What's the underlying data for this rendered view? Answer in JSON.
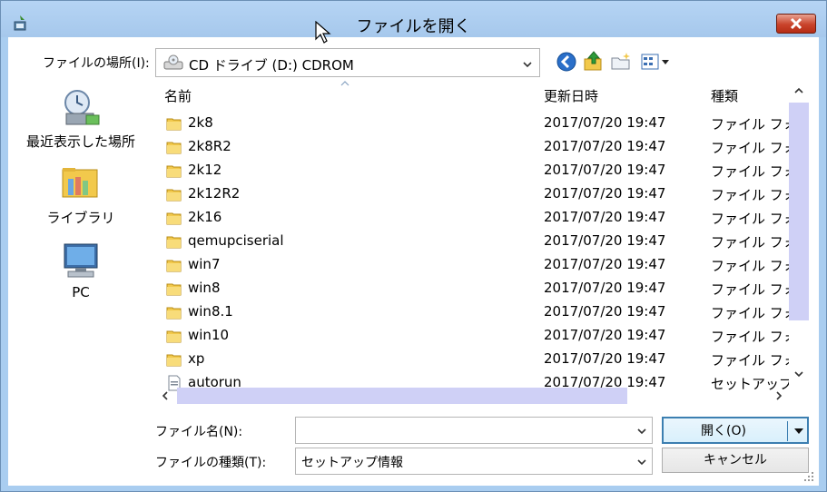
{
  "window": {
    "title": "ファイルを開く"
  },
  "location": {
    "label": "ファイルの場所(I):",
    "value": "CD ドライブ (D:) CDROM"
  },
  "toolbar": {
    "icons": [
      "back-icon",
      "up-folder-icon",
      "new-folder-icon",
      "view-menu-icon"
    ]
  },
  "places": [
    {
      "label": "最近表示した場所",
      "icon": "recent-places-icon"
    },
    {
      "label": "ライブラリ",
      "icon": "libraries-icon"
    },
    {
      "label": "PC",
      "icon": "computer-icon"
    }
  ],
  "columns": {
    "name": "名前",
    "date": "更新日時",
    "type": "種類"
  },
  "files": [
    {
      "name": "2k8",
      "date": "2017/07/20 19:47",
      "type": "ファイル フォルダー",
      "kind": "folder"
    },
    {
      "name": "2k8R2",
      "date": "2017/07/20 19:47",
      "type": "ファイル フォルダー",
      "kind": "folder"
    },
    {
      "name": "2k12",
      "date": "2017/07/20 19:47",
      "type": "ファイル フォルダー",
      "kind": "folder"
    },
    {
      "name": "2k12R2",
      "date": "2017/07/20 19:47",
      "type": "ファイル フォルダー",
      "kind": "folder"
    },
    {
      "name": "2k16",
      "date": "2017/07/20 19:47",
      "type": "ファイル フォルダー",
      "kind": "folder"
    },
    {
      "name": "qemupciserial",
      "date": "2017/07/20 19:47",
      "type": "ファイル フォルダー",
      "kind": "folder"
    },
    {
      "name": "win7",
      "date": "2017/07/20 19:47",
      "type": "ファイル フォルダー",
      "kind": "folder"
    },
    {
      "name": "win8",
      "date": "2017/07/20 19:47",
      "type": "ファイル フォルダー",
      "kind": "folder"
    },
    {
      "name": "win8.1",
      "date": "2017/07/20 19:47",
      "type": "ファイル フォルダー",
      "kind": "folder"
    },
    {
      "name": "win10",
      "date": "2017/07/20 19:47",
      "type": "ファイル フォルダー",
      "kind": "folder"
    },
    {
      "name": "xp",
      "date": "2017/07/20 19:47",
      "type": "ファイル フォルダー",
      "kind": "folder"
    },
    {
      "name": "autorun",
      "date": "2017/07/20 19:47",
      "type": "セットアップ情報",
      "kind": "file"
    }
  ],
  "filename": {
    "label": "ファイル名(N):",
    "value": ""
  },
  "filetype": {
    "label": "ファイルの種類(T):",
    "value": "セットアップ情報"
  },
  "buttons": {
    "open": "開く(O)",
    "cancel": "キャンセル"
  }
}
